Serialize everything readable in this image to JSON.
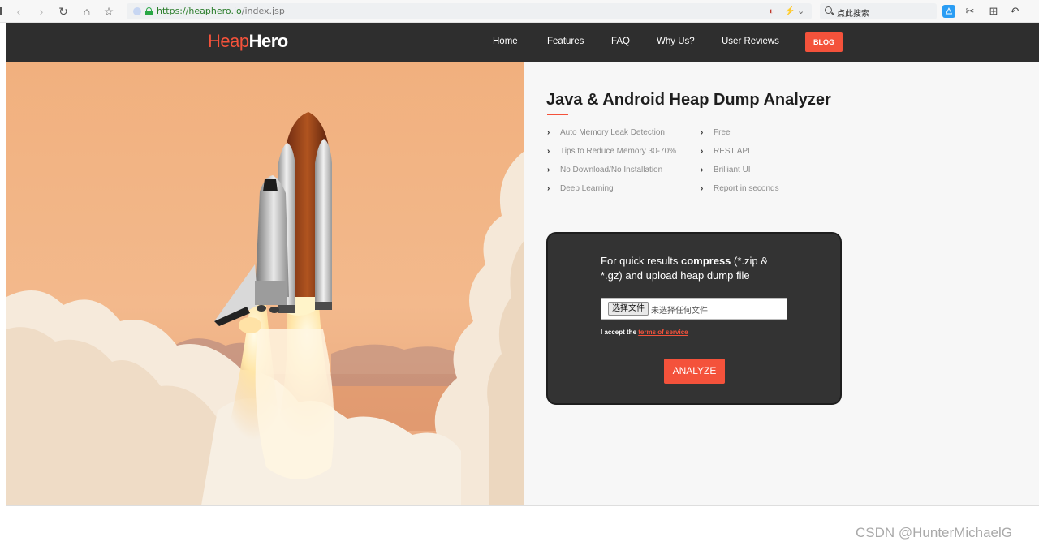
{
  "browser": {
    "url_host": "https://heaphero.io",
    "url_path": "/index.jsp",
    "search_placeholder": "点此搜索"
  },
  "site": {
    "logo_heap": "Heap",
    "logo_hero": "Hero",
    "nav": [
      "Home",
      "Features",
      "FAQ",
      "Why Us?",
      "User Reviews"
    ],
    "blog_label": "BLOG"
  },
  "content": {
    "headline": "Java & Android Heap Dump Analyzer",
    "features_left": [
      "Auto Memory Leak Detection",
      "Tips to Reduce Memory 30-70%",
      "No Download/No Installation",
      "Deep Learning"
    ],
    "features_right": [
      "Free",
      "REST API",
      "Brilliant UI",
      "Report in seconds"
    ]
  },
  "upload": {
    "text_before": "For quick results ",
    "text_bold": "compress",
    "text_after": " (*.zip & *.gz) and upload heap dump file",
    "file_button": "选择文件",
    "file_status": "未选择任何文件",
    "terms_prefix": "I accept the ",
    "terms_link": "terms of service",
    "analyze_label": "ANALYZE"
  },
  "watermark": "CSDN @HunterMichaelG",
  "colors": {
    "accent": "#f4523b",
    "header_bg": "#2e2e2e",
    "card_bg": "#333333",
    "panel_bg": "#f7f7f7"
  }
}
